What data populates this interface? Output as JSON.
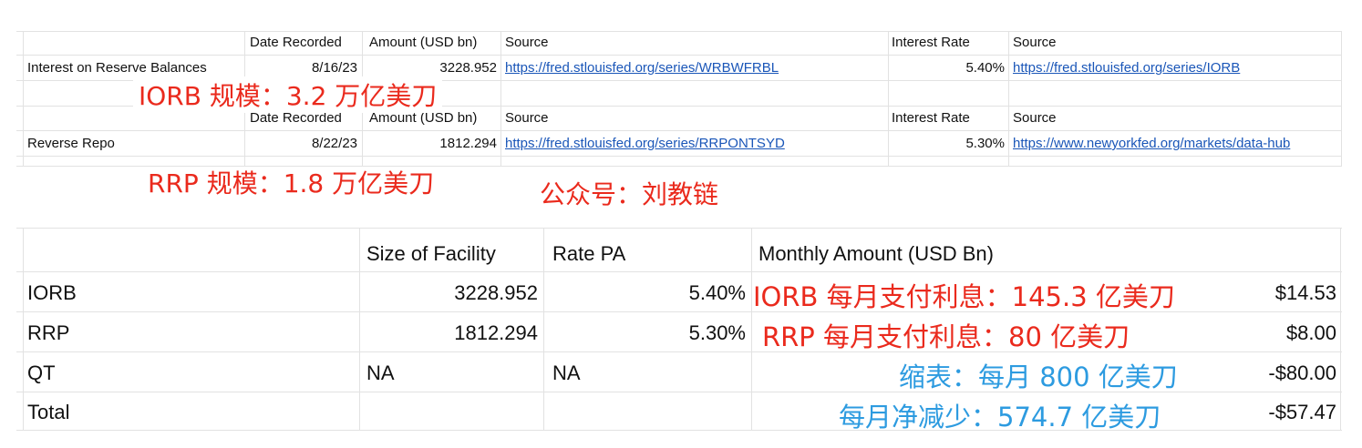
{
  "sheet1": {
    "headers": {
      "date": "Date Recorded",
      "amount": "Amount (USD bn)",
      "source": "Source",
      "rate": "Interest Rate",
      "source2": "Source"
    },
    "rows": [
      {
        "name": "Interest on Reserve Balances",
        "date": "8/16/23",
        "amount": "3228.952",
        "source": "https://fred.stlouisfed.org/series/WRBWFRBL",
        "rate": "5.40%",
        "rate_source": "https://fred.stlouisfed.org/series/IORB"
      },
      {
        "name": "Reverse Repo",
        "date": "8/22/23",
        "amount": "1812.294",
        "source": "https://fred.stlouisfed.org/series/RRPONTSYD",
        "rate": "5.30%",
        "rate_source": "https://www.newyorkfed.org/markets/data-hub"
      }
    ]
  },
  "annotations": {
    "iorb_size": "IORB 规模：3.2 万亿美刀",
    "rrp_size": "RRP 规模：1.8 万亿美刀",
    "wechat": "公众号：刘教链",
    "iorb_monthly": "IORB 每月支付利息：145.3 亿美刀",
    "rrp_monthly": "RRP 每月支付利息：80 亿美刀",
    "qt_monthly": "缩表：每月 800 亿美刀",
    "net_monthly": "每月净减少：574.7 亿美刀"
  },
  "sheet2": {
    "headers": {
      "size": "Size of Facility",
      "rate": "Rate PA",
      "monthly": "Monthly Amount (USD Bn)"
    },
    "rows": [
      {
        "name": "IORB",
        "size": "3228.952",
        "rate": "5.40%",
        "monthly": "$14.53"
      },
      {
        "name": "RRP",
        "size": "1812.294",
        "rate": "5.30%",
        "monthly": "$8.00"
      },
      {
        "name": "QT",
        "size": "NA",
        "rate": "NA",
        "monthly": "-$80.00"
      },
      {
        "name": "Total",
        "size": "",
        "rate": "",
        "monthly": "-$57.47"
      }
    ]
  },
  "colors": {
    "annotation_red": "#ea2a1d",
    "annotation_blue": "#2d9be0",
    "link": "#1a56b8",
    "gridline": "#e2e2e2"
  }
}
